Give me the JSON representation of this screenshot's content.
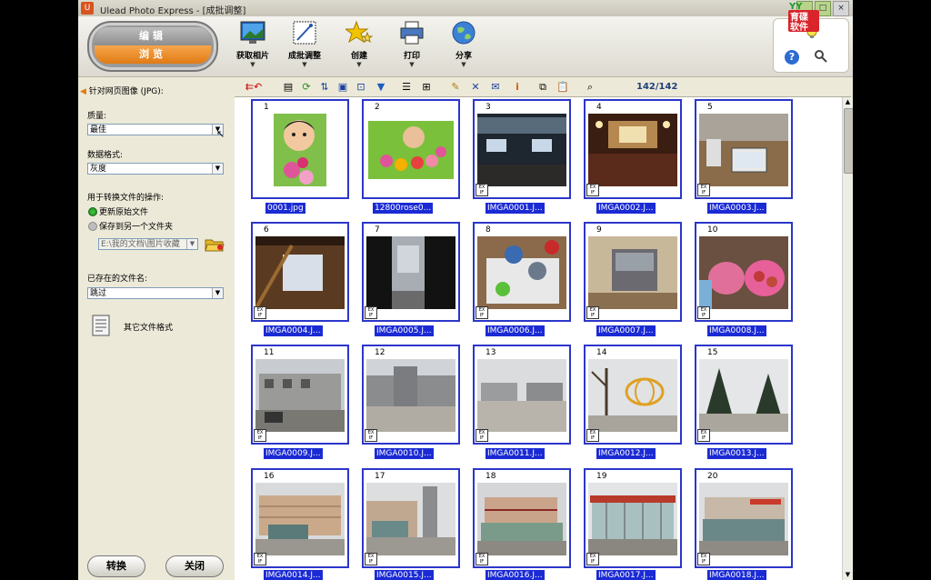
{
  "window": {
    "title": "Ulead Photo Express - [成批调整]"
  },
  "mode": {
    "edit": "编辑",
    "browse": "浏览"
  },
  "tools": [
    {
      "label": "获取相片",
      "icon": "monitor-icon"
    },
    {
      "label": "成批调整",
      "icon": "batch-icon"
    },
    {
      "label": "创建",
      "icon": "star-icon"
    },
    {
      "label": "打印",
      "icon": "printer-icon"
    },
    {
      "label": "分享",
      "icon": "globe-icon"
    }
  ],
  "logo": {
    "text": "育碟软件"
  },
  "left_panel": {
    "target": "针对网页图像 (JPG):",
    "quality_label": "质量:",
    "quality_value": "最佳",
    "format_label": "数据格式:",
    "format_value": "灰度",
    "operation_label": "用于转换文件的操作:",
    "radio_update": "更新原始文件",
    "radio_save": "保存到另一个文件夹",
    "folder_path": "E:\\我的文档\\图片收藏",
    "existing_label": "已存在的文件名:",
    "existing_value": "跳过",
    "other_formats": "其它文件格式",
    "convert_button": "转换",
    "close_button": "关闭"
  },
  "toolbar": {
    "count": "142/142"
  },
  "thumbnails": [
    {
      "n": "1",
      "caption": "0001.jpg"
    },
    {
      "n": "2",
      "caption": "12800rose0..."
    },
    {
      "n": "3",
      "caption": "IMGA0001.J..."
    },
    {
      "n": "4",
      "caption": "IMGA0002.J..."
    },
    {
      "n": "5",
      "caption": "IMGA0003.J..."
    },
    {
      "n": "6",
      "caption": "IMGA0004.J..."
    },
    {
      "n": "7",
      "caption": "IMGA0005.J..."
    },
    {
      "n": "8",
      "caption": "IMGA0006.J..."
    },
    {
      "n": "9",
      "caption": "IMGA0007.J..."
    },
    {
      "n": "10",
      "caption": "IMGA0008.J..."
    },
    {
      "n": "11",
      "caption": "IMGA0009.J..."
    },
    {
      "n": "12",
      "caption": "IMGA0010.J..."
    },
    {
      "n": "13",
      "caption": "IMGA0011.J..."
    },
    {
      "n": "14",
      "caption": "IMGA0012.J..."
    },
    {
      "n": "15",
      "caption": "IMGA0013.J..."
    },
    {
      "n": "16",
      "caption": "IMGA0014.J..."
    },
    {
      "n": "17",
      "caption": "IMGA0015.J..."
    },
    {
      "n": "18",
      "caption": "IMGA0016.J..."
    },
    {
      "n": "19",
      "caption": "IMGA0017.J..."
    },
    {
      "n": "20",
      "caption": "IMGA0018.J..."
    }
  ]
}
